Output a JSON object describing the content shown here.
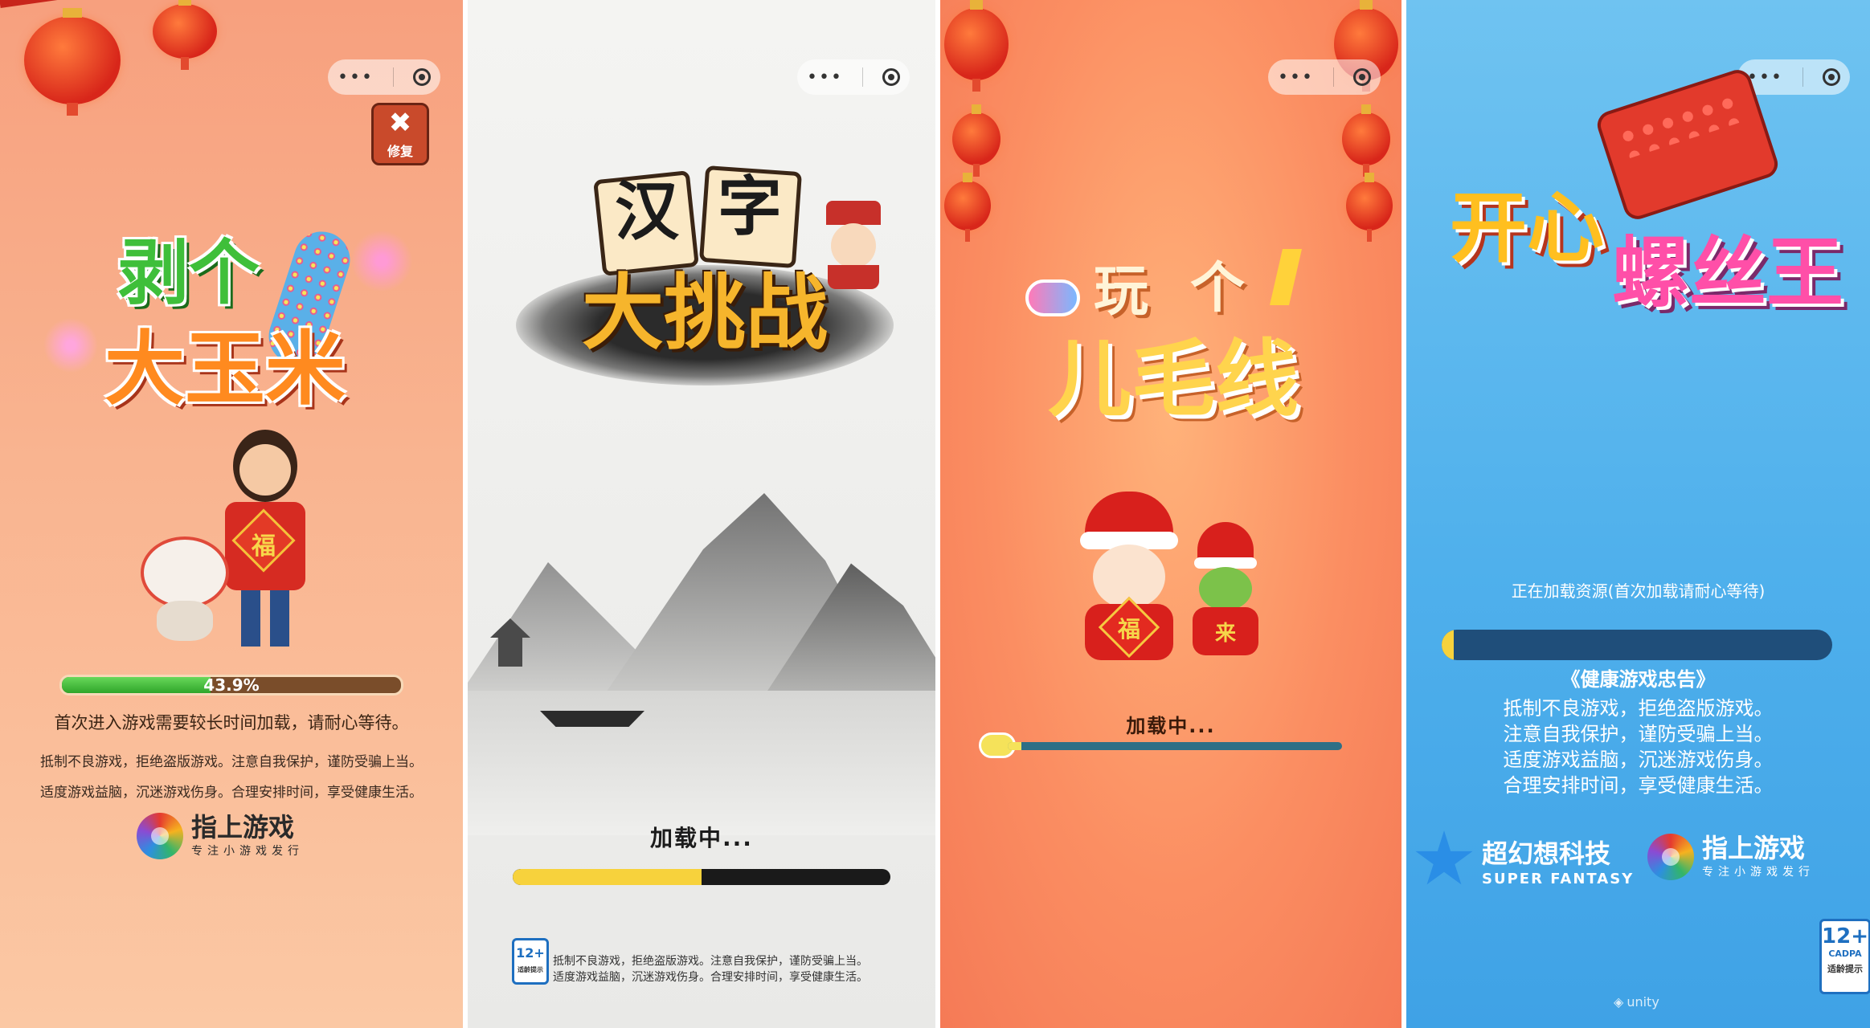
{
  "panel1": {
    "capsule_dots": "•••",
    "repair_icon_label": "修复",
    "title_line1": "剥个",
    "title_line2": "大玉米",
    "fu_label": "福",
    "progress_text": "43.9%",
    "progress_value": 0.439,
    "notice_loading": "首次进入游戏需要较长时间加载，请耐心等待。",
    "health_line1": "抵制不良游戏，拒绝盗版游戏。注意自我保护，谨防受骗上当。",
    "health_line2": "适度游戏益脑，沉迷游戏伤身。合理安排时间，享受健康生活。",
    "publisher_name": "指上游戏",
    "publisher_tag": "专注小游戏发行"
  },
  "panel2": {
    "capsule_dots": "•••",
    "title_line1_a": "汉",
    "title_line1_b": "字",
    "title_line2": "大挑战",
    "loading_text": "加载中...",
    "progress_value": 0.5,
    "age_badge": "12+",
    "age_badge_sub": "适龄提示",
    "health_line1": "抵制不良游戏，拒绝盗版游戏。注意自我保护，谨防受骗上当。",
    "health_line2": "适度游戏益脑，沉迷游戏伤身。合理安排时间，享受健康生活。"
  },
  "panel3": {
    "capsule_dots": "•••",
    "title_line1_a": "玩",
    "title_line1_b": "个",
    "title_line2": "儿毛线",
    "fu_label": "福",
    "snake_label": "来",
    "loading_text": "加载中...",
    "progress_value": 0.04
  },
  "panel4": {
    "capsule_dots": "•••",
    "title_part1": "开心",
    "title_part2": "螺丝王",
    "loading_text": "正在加载资源(首次加载请耐心等待)",
    "progress_value": 0.03,
    "health_title": "《健康游戏忠告》",
    "health_lines": [
      "抵制不良游戏，拒绝盗版游戏。",
      "注意自我保护，谨防受骗上当。",
      "适度游戏益脑，沉迷游戏伤身。",
      "合理安排时间，享受健康生活。"
    ],
    "sponsor_name": "超幻想科技",
    "sponsor_sub": "SUPER FANTASY",
    "publisher_name": "指上游戏",
    "publisher_tag": "专注小游戏发行",
    "age_badge": "12+",
    "age_badge_org": "CADPA",
    "age_badge_sub": "适龄提示",
    "engine_label": "unity"
  },
  "colors": {
    "progress_green": "#3fbf3a",
    "progress_track_brown": "#7a4d2a",
    "progress_yellow": "#f7d23c",
    "progress_teal": "#2e6f86",
    "progress_navy": "#1f4e7a"
  }
}
